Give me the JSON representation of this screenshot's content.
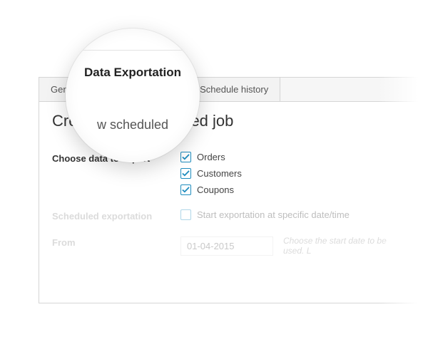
{
  "tabs": {
    "general": "General",
    "data_exportation": "Data Exportation",
    "schedule_history": "Schedule history"
  },
  "page_title": "Create new scheduled job",
  "form": {
    "choose_label": "Choose data to export",
    "options": {
      "orders": "Orders",
      "customers": "Customers",
      "coupons": "Coupons"
    },
    "scheduled_label": "Scheduled exportation",
    "scheduled_option": "Start exportation at specific date/time",
    "from_label": "From",
    "from_value": "01-04-2015",
    "from_hint": "Choose the start date to be used. L"
  },
  "lens": {
    "title": "Data Exportation",
    "subtitle_fragment": "w scheduled"
  }
}
